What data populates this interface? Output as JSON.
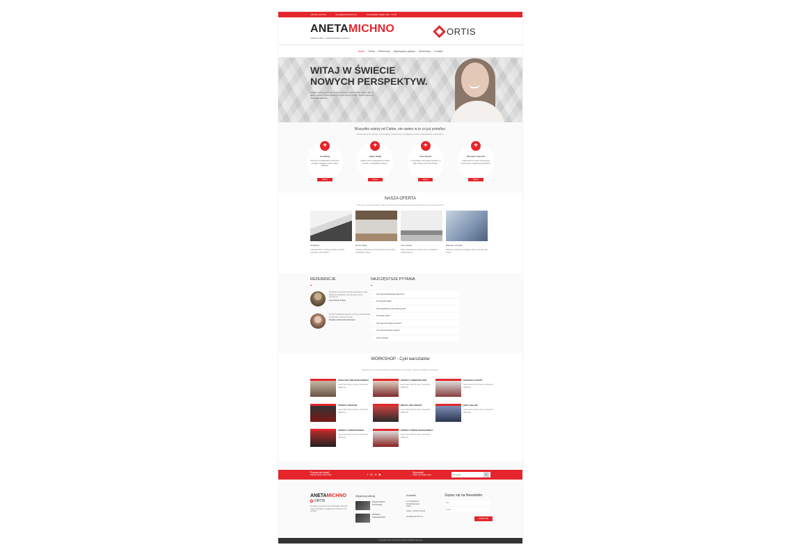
{
  "topbar": {
    "phone": "+48 601 123 456",
    "email": "biuro@anetamichno.pl",
    "hours": "Poniedziałek-Piątek 9:00 - 17:00"
  },
  "header": {
    "logo_part1": "ANETA",
    "logo_part2": "MICHNO",
    "tagline": "KREATYWNY SUPERWIZOR COACH",
    "partner_logo": "ORTIS"
  },
  "nav": {
    "items": [
      "Home",
      "Oferta",
      "Referencje",
      "Najczęstsze pytania",
      "Workshops",
      "Kontakt"
    ]
  },
  "hero": {
    "title": "WITAJ W ŚWIECIE NOWYCH PERSPEKTYW.",
    "text": "Tysiące ludzi poszerzyło swoje horyzonty i wyznaczyło nowe cele. Ty także możesz zrobić pierwszy krok w stronę zmian. Pozwól sobie na nowe perspektywy."
  },
  "intro": {
    "title": "Wszystko zależy od Ciebie, nie uwierz w to co już potrafisz.",
    "subtitle": "Poszerzamy horyzonty, motywujemy i wspieramy w osiąganiu celów zawodowych i osobistych."
  },
  "services": [
    {
      "name": "Coaching",
      "desc": "Pomocny w rozwiązywaniu problemów, pomaga w osiąganiu celów i zmianie nawyków.",
      "button": "Więcej"
    },
    {
      "name": "Home Study",
      "desc": "Nauka w domu dopasowana do Twoich potrzeb, z indywidualnym planem.",
      "button": "Więcej"
    },
    {
      "name": "Your Choice",
      "desc": "Ty decydujesz, którą drogę wybierasz i w jakim tempie chcesz się rozwijać.",
      "button": "Więcej"
    },
    {
      "name": "Discover Yourself",
      "desc": "Odkryj siebie na nowo i poznaj swoje mocne strony w bezpiecznej atmosferze.",
      "button": "Więcej"
    }
  ],
  "oferta": {
    "title": "NASZA OFERTA",
    "subtitle": "Oferujemy szeroki wachlarz usług coachingowych i szkoleniowych dopasowanych do Twoich potrzeb.",
    "items": [
      {
        "title": "Coaching",
        "text": "Coaching kariery, coaching osobisty, coaching zespołowy i przywództwa."
      },
      {
        "title": "Home Study",
        "text": "Programy szkoleniowe do samodzielnej nauki w domu, w dogodnym czasie."
      },
      {
        "title": "Your Choice",
        "text": "Sesje dopasowane do Twoich celów i oczekiwań, w wybranej formie."
      },
      {
        "title": "Discover Yourself",
        "text": "Warsztaty rozwojowe pomagające odkryć swój potencjał i pasję."
      }
    ]
  },
  "referencje": {
    "title": "REFERENCJE",
    "items": [
      {
        "quote": "Spotkania z Anetą były dla mnie inspiracją do zmian. Dzięki nim odnalazłem nowy kierunek w życiu zawodowym.",
        "author": "Paweł Nowak, Kraków"
      },
      {
        "quote": "Polecam współpracę każdemu, kto chce rozwinąć swoje umiejętności i uwierzyć w siebie.",
        "author": "Magdalena Wiśniewska, Warszawa"
      }
    ]
  },
  "faq": {
    "title": "NAJCZĘSTSZE PYTANIA",
    "items": [
      "Czy sesja coachingowa jest dla mnie?",
      "Ile trwa jedna sesja?",
      "Jak przygotować się do pierwszej sesji?",
      "Ile kosztuje sesja?",
      "Czy sesja może odbyć się online?",
      "Czy można pracować w grupie?",
      "Jak się zapisać?"
    ]
  },
  "workshop": {
    "title": "WORKSHOP - Cykl warsztatów",
    "subtitle": "Zapraszamy na cykl warsztatów rozwojowych. Szczegóły i zapisy w zakładce workshopy.",
    "items": [
      {
        "title": "EFFECTIVE TIME MANAGEMENT",
        "text": "Lorem ipsum dolor sit amet, consectetur adipiscing."
      },
      {
        "title": "PERFECT COMMUNICATOR",
        "text": "Lorem ipsum dolor sit amet, consectetur adipiscing."
      },
      {
        "title": "PERSONAL EXPERT",
        "text": "Lorem ipsum dolor sit amet, consectetur adipiscing."
      },
      {
        "title": "PERFECT SPEAKER",
        "text": "Lorem ipsum dolor sit amet, consectetur adipiscing."
      },
      {
        "title": "MENTAL INFLUENCER",
        "text": "Lorem ipsum dolor sit amet, consectetur adipiscing."
      },
      {
        "title": "BODY FEELING",
        "text": "Lorem ipsum dolor sit amet, consectetur adipiscing."
      },
      {
        "title": "PERFECT ASSERTIVENESS",
        "text": "Lorem ipsum dolor sit amet, consectetur adipiscing."
      },
      {
        "title": "PERFECT STRESS MANAGEMENT",
        "text": "Lorem ipsum dolor sit amet, consectetur adipiscing."
      }
    ]
  },
  "redbar": {
    "left_title": "Poznaj nas lepiej!",
    "left_sub": "Odwiedź nasze social media",
    "mid_title": "Wyszukaj!",
    "mid_sub": "Znajdź interesujące treści",
    "search_placeholder": "Wyszukaj"
  },
  "footer": {
    "logo_part1": "ANETA",
    "logo_part2": "MICHNO",
    "partner": "ORTIS",
    "about": "Kreatywny superwizor coach. Pomagam odkrywać nowe perspektywy i osiągać cele zawodowe oraz osobiste.",
    "col2_title": "Wyprobuj ofertę",
    "col2_items": [
      {
        "line1": "Zestaw Szkoleń",
        "line2": "Home Study"
      },
      {
        "line1": "Workshop",
        "line2": "Cykl warsztatów"
      }
    ],
    "col3_title": "Kontakt",
    "col3_text": "ul. Przykładowa 1\n00-000 Warszawa\nPolska\n\nTelefon: +48 601 123 456\n\nbiuro@anetamichno.pl",
    "col4_title": "Zapisz się na Newsletter",
    "name_placeholder": "Imię",
    "email_placeholder": "E-mail",
    "submit": "ZAPISZ SIĘ"
  },
  "copyright": "© Copyright 2016 Aneta Michno ORTIS. All Rights Reserved.",
  "colors": {
    "accent": "#e4262c",
    "dark": "#333333"
  }
}
